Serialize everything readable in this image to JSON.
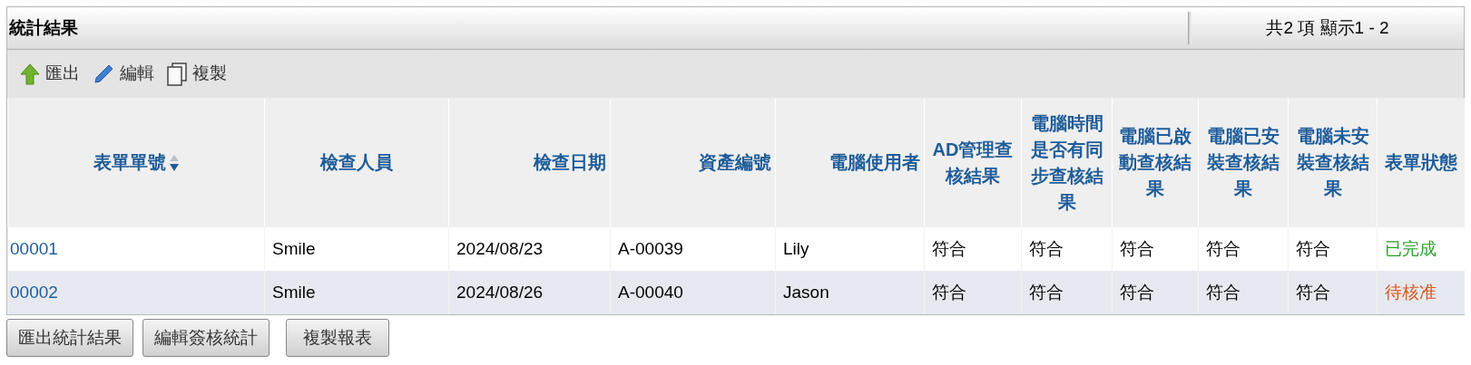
{
  "panel": {
    "title": "統計結果",
    "pager": "共2 項 顯示1 - 2"
  },
  "toolbar": [
    {
      "kind": "export",
      "label": "匯出"
    },
    {
      "kind": "edit",
      "label": "編輯"
    },
    {
      "kind": "copy",
      "label": "複製"
    }
  ],
  "table": {
    "columns": [
      {
        "label": "表單單號",
        "sortable": true
      },
      {
        "label": "檢查人員",
        "sortable": false
      },
      {
        "label": "檢查日期",
        "sortable": false
      },
      {
        "label": "資產編號",
        "sortable": false
      },
      {
        "label": "電腦使用者",
        "sortable": false
      },
      {
        "label": "AD管理查核結果",
        "sortable": false
      },
      {
        "label": "電腦時間是否有同步查核結果",
        "sortable": false
      },
      {
        "label": "電腦已啟動查核結果",
        "sortable": false
      },
      {
        "label": "電腦已安裝查核結果",
        "sortable": false
      },
      {
        "label": "電腦未安裝查核結果",
        "sortable": false
      },
      {
        "label": "表單狀態",
        "sortable": false
      }
    ],
    "rows": [
      {
        "cells": [
          "00001",
          "Smile",
          "2024/08/23",
          "A-00039",
          "Lily",
          "符合",
          "符合",
          "符合",
          "符合",
          "符合"
        ],
        "status": {
          "text": "已完成",
          "color": "#2ca02c"
        }
      },
      {
        "cells": [
          "00002",
          "Smile",
          "2024/08/26",
          "A-00040",
          "Jason",
          "符合",
          "符合",
          "符合",
          "符合",
          "符合"
        ],
        "status": {
          "text": "待核准",
          "color": "#d9541e"
        }
      }
    ]
  },
  "buttons": [
    "匯出統計結果",
    "編輯簽核統計",
    "複製報表"
  ]
}
